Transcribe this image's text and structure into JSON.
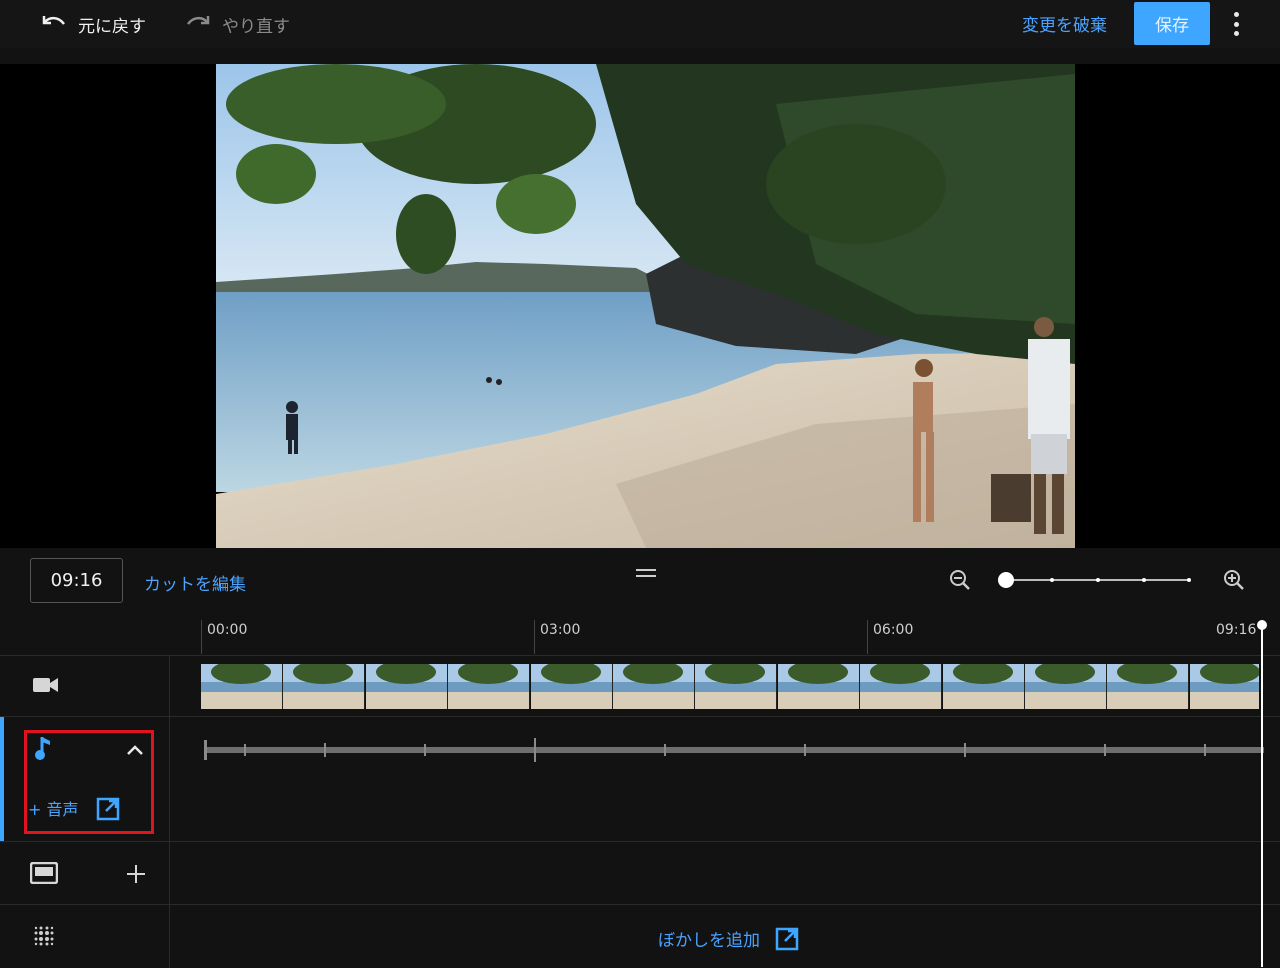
{
  "toolbar": {
    "undo_label": "元に戻す",
    "redo_label": "やり直す",
    "discard_label": "変更を破棄",
    "save_label": "保存"
  },
  "controls": {
    "current_time": "09:16",
    "edit_cut_label": "カットを編集"
  },
  "ruler": {
    "ticks": [
      "00:00",
      "03:00",
      "06:00",
      "09:16"
    ]
  },
  "tracks": {
    "video_icon": "video-camera-icon",
    "audio_icon": "music-note-icon",
    "audio_add_label": "+ 音声",
    "overlay_icon": "end-screen-icon",
    "blur_icon": "blur-icon",
    "blur_add_label": "ぼかしを追加"
  },
  "colors": {
    "accent": "#3ea6ff",
    "link": "#4aa3ff",
    "highlight": "#e0141e",
    "background": "#121212"
  }
}
